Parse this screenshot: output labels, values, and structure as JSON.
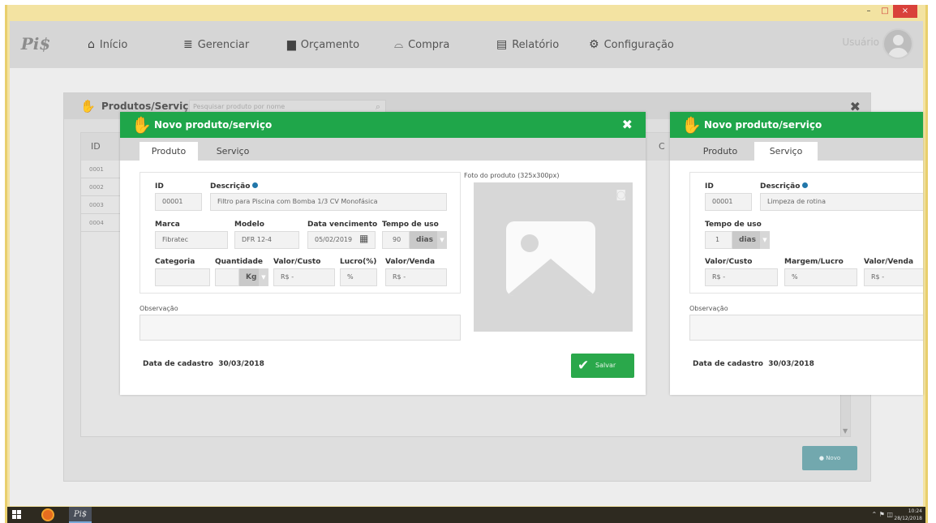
{
  "window": {
    "min_label": "–",
    "max_label": "□",
    "close_label": "×"
  },
  "app": {
    "logo_text": "Pi$"
  },
  "nav": {
    "items": [
      {
        "label": "Início",
        "icon": "home-icon"
      },
      {
        "label": "Gerenciar",
        "icon": "database-icon"
      },
      {
        "label": "Orçamento",
        "icon": "file-icon"
      },
      {
        "label": "Compra",
        "icon": "basket-icon"
      },
      {
        "label": "Relatório",
        "icon": "report-icon"
      },
      {
        "label": "Configuração",
        "icon": "gear-icon"
      }
    ],
    "user_label": "Usuário"
  },
  "background_panel": {
    "title": "Produtos/Serviços",
    "search_placeholder": "Pesquisar produto por nome",
    "table": {
      "col_id": "ID",
      "col_c": "C",
      "rows": [
        "0001",
        "0002",
        "0003",
        "0004"
      ]
    },
    "novo_button": "Novo"
  },
  "modal_produto": {
    "title": "Novo produto/serviço",
    "tabs": [
      "Produto",
      "Serviço"
    ],
    "active_tab": "Produto",
    "labels": {
      "id": "ID",
      "descricao": "Descrição",
      "marca": "Marca",
      "modelo": "Modelo",
      "data_vencimento": "Data vencimento",
      "tempo_uso": "Tempo de uso",
      "categoria": "Categoria",
      "quantidade": "Quantidade",
      "valor_custo": "Valor/Custo",
      "lucro": "Lucro(%)",
      "valor_venda": "Valor/Venda",
      "observacao": "Observação",
      "foto": "Foto do produto (325x300px)",
      "data_cadastro": "Data de cadastro"
    },
    "values": {
      "id": "00001",
      "descricao": "Filtro para Piscina com Bomba 1/3 CV Monofásica",
      "marca": "Fibratec",
      "modelo": "DFR 12-4",
      "data_vencimento": "05/02/2019",
      "tempo_uso": "90",
      "tempo_uso_unit": "dias",
      "categoria": "",
      "quantidade": "",
      "quantidade_unit": "Kg",
      "valor_custo": "R$ -",
      "lucro": "%",
      "valor_venda": "R$ -",
      "observacao": "",
      "data_cadastro": "30/03/2018"
    },
    "save_button": "Salvar"
  },
  "modal_servico": {
    "title": "Novo produto/serviço",
    "tabs": [
      "Produto",
      "Serviço"
    ],
    "active_tab": "Serviço",
    "labels": {
      "id": "ID",
      "descricao": "Descrição",
      "tempo_uso": "Tempo de uso",
      "valor_custo": "Valor/Custo",
      "margem_lucro": "Margem/Lucro",
      "valor_venda": "Valor/Venda",
      "observacao": "Observação",
      "data_cadastro": "Data de cadastro"
    },
    "values": {
      "id": "00001",
      "descricao": "Limpeza de rotina",
      "tempo_uso": "1",
      "tempo_uso_unit": "dias",
      "valor_custo": "R$ -",
      "margem_lucro": "%",
      "valor_venda": "R$ -",
      "observacao": "",
      "data_cadastro": "30/03/2018"
    }
  },
  "taskbar": {
    "app_label": "Pi$",
    "time": "10:24",
    "date": "28/12/2018"
  },
  "colors": {
    "header_green": "#1fa64a",
    "save_green": "#2aa84b",
    "novo_teal": "#72a8ae",
    "screen_yellow": "#f3e3a2"
  }
}
